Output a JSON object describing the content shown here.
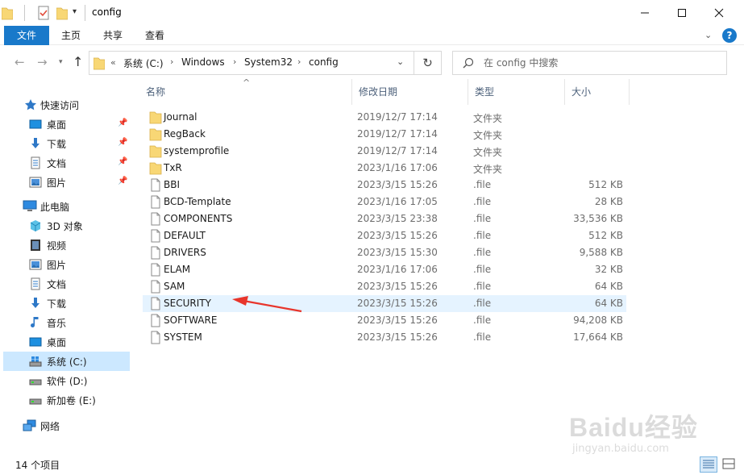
{
  "window": {
    "title": "config",
    "controls": {
      "minimize": "—",
      "maximize": "☐",
      "close": "✕"
    }
  },
  "ribbon": {
    "tabs": [
      "文件",
      "主页",
      "共享",
      "查看"
    ],
    "help": "?"
  },
  "navigation": {
    "path_prefix": "«",
    "breadcrumbs": [
      "系统 (C:)",
      "Windows",
      "System32",
      "config"
    ],
    "search_placeholder": "在 config 中搜索"
  },
  "sidebar": {
    "quick_access": {
      "label": "快速访问",
      "items": [
        {
          "label": "桌面",
          "icon": "desktop-icon",
          "pinned": true
        },
        {
          "label": "下载",
          "icon": "download-icon",
          "pinned": true
        },
        {
          "label": "文档",
          "icon": "documents-icon",
          "pinned": true
        },
        {
          "label": "图片",
          "icon": "pictures-icon",
          "pinned": true
        }
      ]
    },
    "this_pc": {
      "label": "此电脑",
      "items": [
        {
          "label": "3D 对象",
          "icon": "3d-objects-icon"
        },
        {
          "label": "视频",
          "icon": "videos-icon"
        },
        {
          "label": "图片",
          "icon": "pictures-icon"
        },
        {
          "label": "文档",
          "icon": "documents-icon"
        },
        {
          "label": "下载",
          "icon": "download-icon"
        },
        {
          "label": "音乐",
          "icon": "music-icon"
        },
        {
          "label": "桌面",
          "icon": "desktop-icon"
        },
        {
          "label": "系统 (C:)",
          "icon": "system-drive-icon",
          "selected": true
        },
        {
          "label": "软件 (D:)",
          "icon": "drive-icon"
        },
        {
          "label": "新加卷 (E:)",
          "icon": "drive-icon"
        }
      ]
    },
    "network": {
      "label": "网络",
      "icon": "network-icon"
    }
  },
  "columns": {
    "name": "名称",
    "date": "修改日期",
    "type": "类型",
    "size": "大小"
  },
  "files": [
    {
      "name": "Journal",
      "date": "2019/12/7 17:14",
      "type": "文件夹",
      "size": "",
      "kind": "folder"
    },
    {
      "name": "RegBack",
      "date": "2019/12/7 17:14",
      "type": "文件夹",
      "size": "",
      "kind": "folder"
    },
    {
      "name": "systemprofile",
      "date": "2019/12/7 17:14",
      "type": "文件夹",
      "size": "",
      "kind": "folder"
    },
    {
      "name": "TxR",
      "date": "2023/1/16 17:06",
      "type": "文件夹",
      "size": "",
      "kind": "folder"
    },
    {
      "name": "BBI",
      "date": "2023/3/15 15:26",
      "type": ".file",
      "size": "512 KB",
      "kind": "file"
    },
    {
      "name": "BCD-Template",
      "date": "2023/1/16 17:05",
      "type": ".file",
      "size": "28 KB",
      "kind": "file"
    },
    {
      "name": "COMPONENTS",
      "date": "2023/3/15 23:38",
      "type": ".file",
      "size": "33,536 KB",
      "kind": "file"
    },
    {
      "name": "DEFAULT",
      "date": "2023/3/15 15:26",
      "type": ".file",
      "size": "512 KB",
      "kind": "file"
    },
    {
      "name": "DRIVERS",
      "date": "2023/3/15 15:30",
      "type": ".file",
      "size": "9,588 KB",
      "kind": "file"
    },
    {
      "name": "ELAM",
      "date": "2023/1/16 17:06",
      "type": ".file",
      "size": "32 KB",
      "kind": "file"
    },
    {
      "name": "SAM",
      "date": "2023/3/15 15:26",
      "type": ".file",
      "size": "64 KB",
      "kind": "file"
    },
    {
      "name": "SECURITY",
      "date": "2023/3/15 15:26",
      "type": ".file",
      "size": "64 KB",
      "kind": "file",
      "highlighted": true
    },
    {
      "name": "SOFTWARE",
      "date": "2023/3/15 15:26",
      "type": ".file",
      "size": "94,208 KB",
      "kind": "file"
    },
    {
      "name": "SYSTEM",
      "date": "2023/3/15 15:26",
      "type": ".file",
      "size": "17,664 KB",
      "kind": "file"
    }
  ],
  "status": {
    "item_count": "14 个项目"
  },
  "watermark": {
    "logo": "Baidu经验",
    "url": "jingyan.baidu.com"
  },
  "colors": {
    "accent": "#1979ca",
    "selection": "#cce8ff",
    "hover_row": "#e5f3ff",
    "folder": "#f8d775",
    "annotation_arrow": "#e8352b",
    "header_text": "#4c607a"
  }
}
